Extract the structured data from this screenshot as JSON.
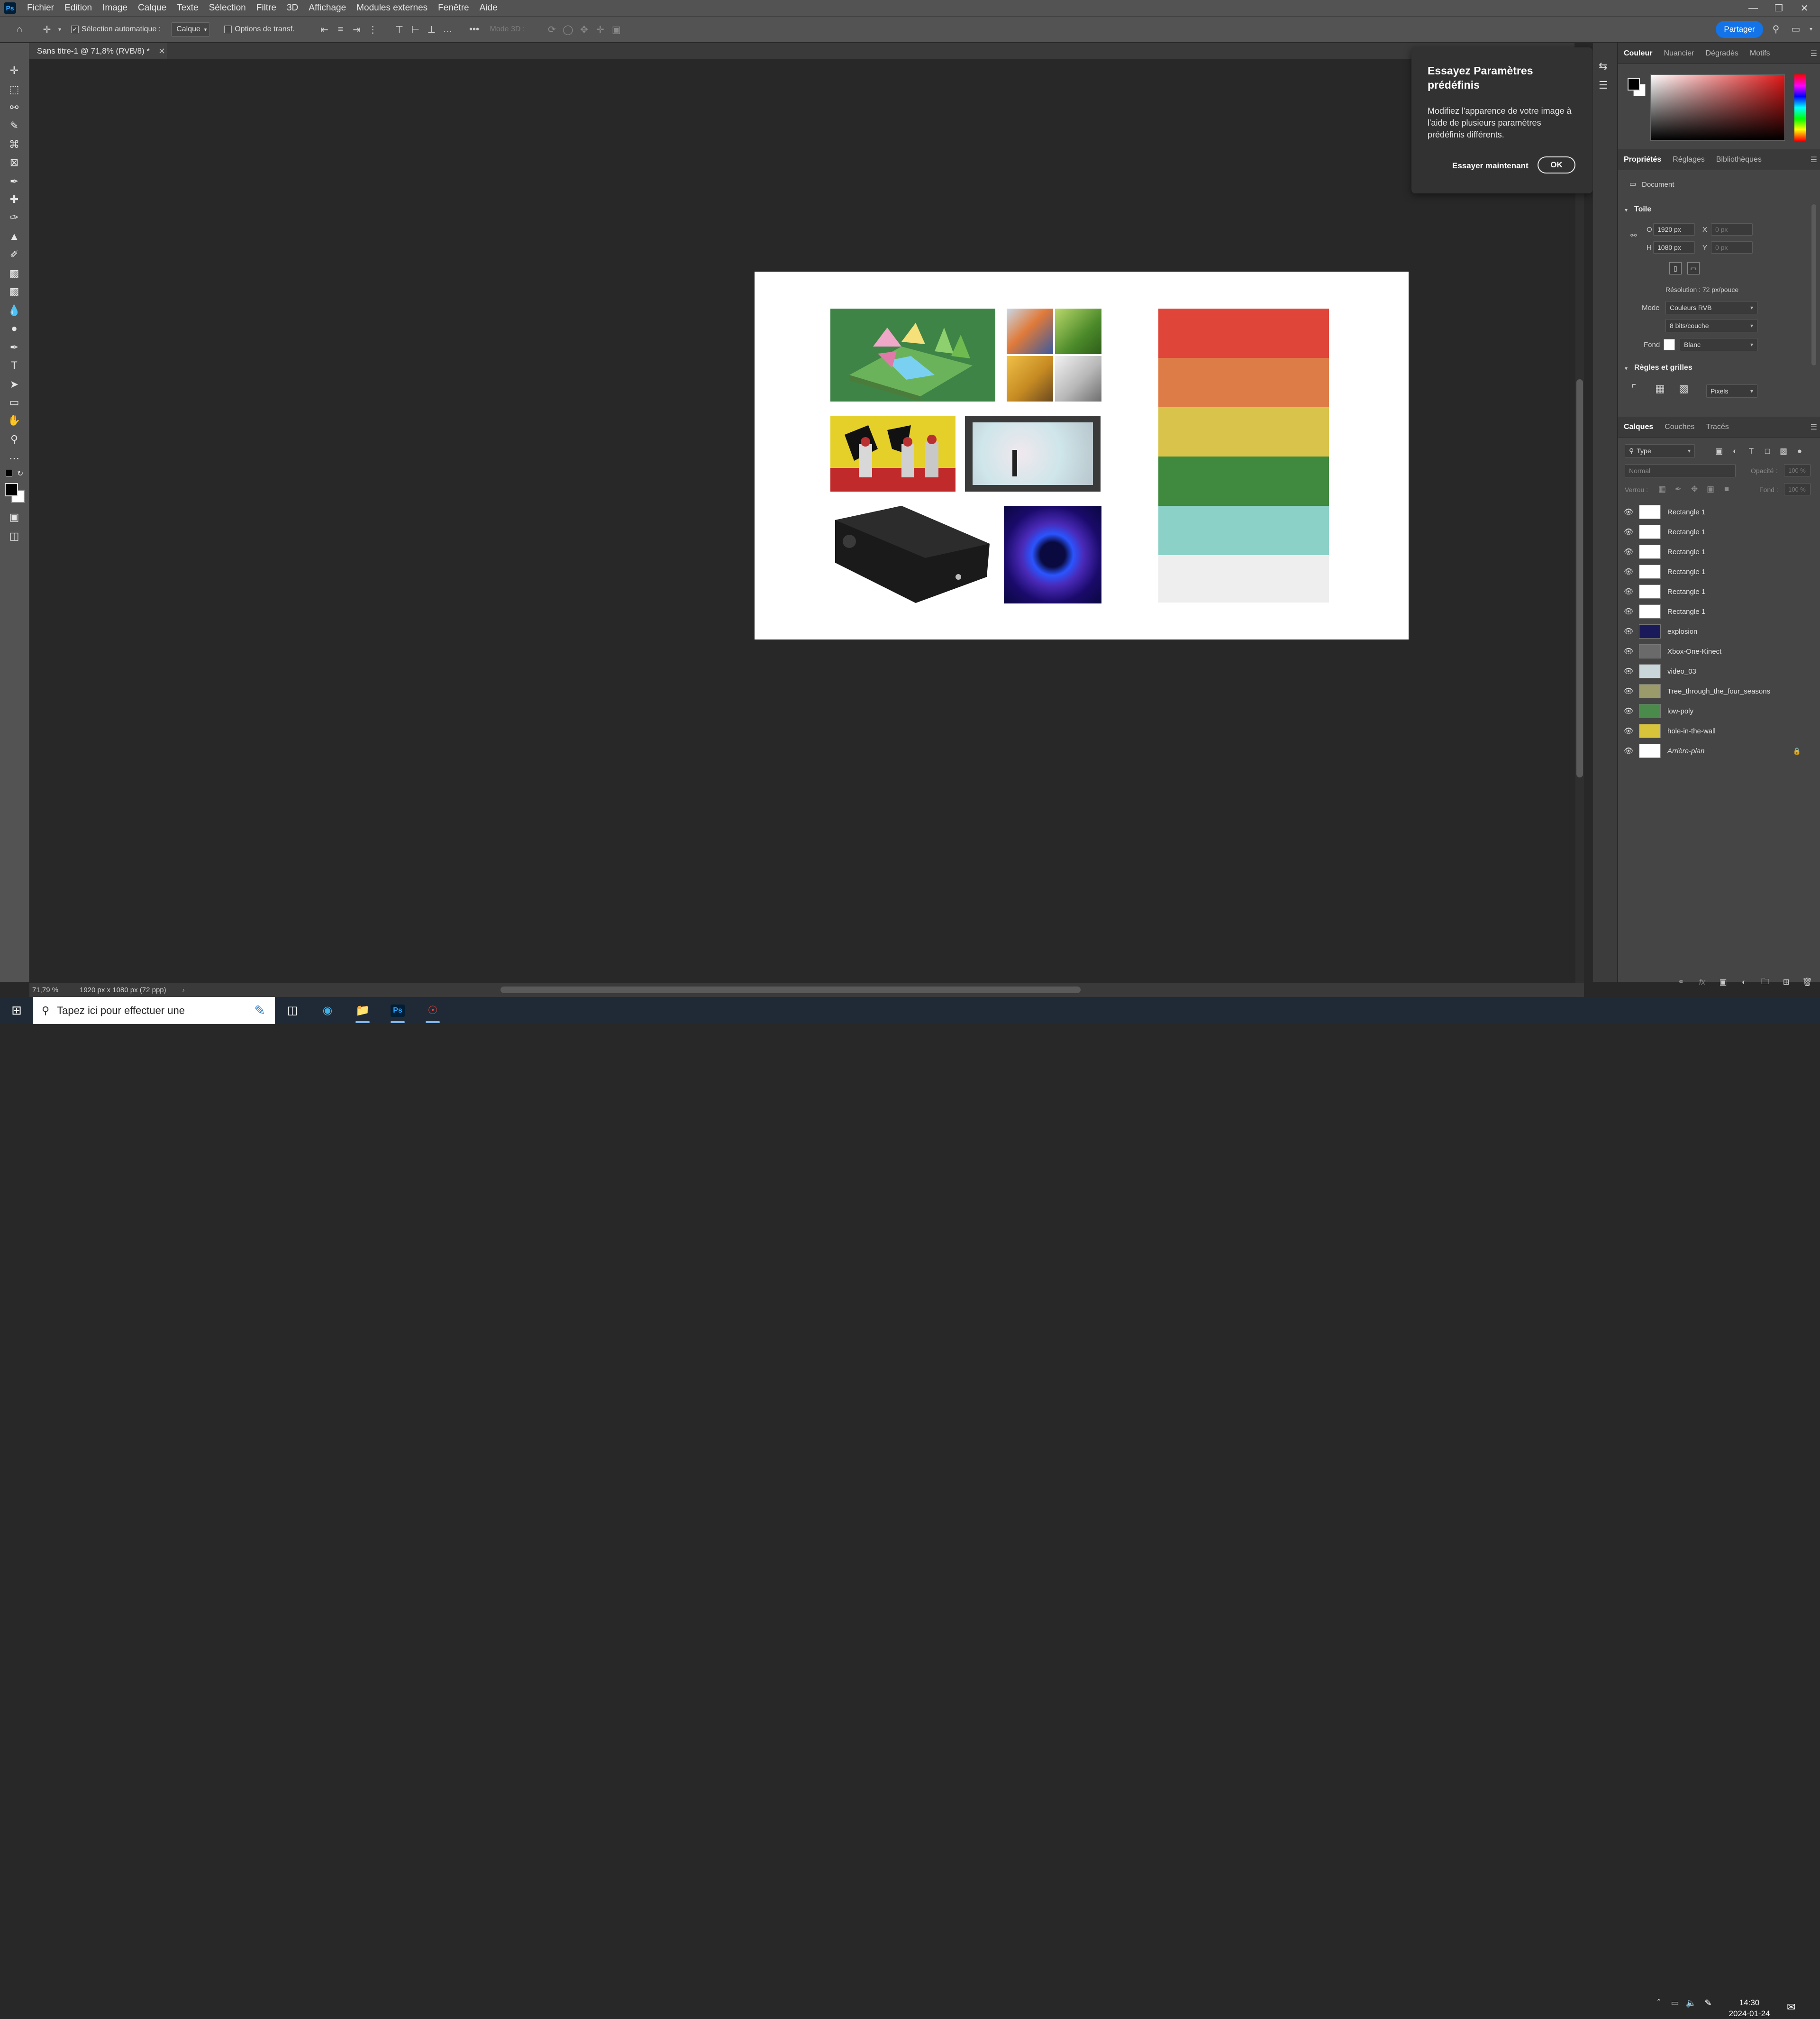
{
  "app": {
    "name": "Ps",
    "menu": [
      "Fichier",
      "Edition",
      "Image",
      "Calque",
      "Texte",
      "Sélection",
      "Filtre",
      "3D",
      "Affichage",
      "Modules externes",
      "Fenêtre",
      "Aide"
    ]
  },
  "options_bar": {
    "auto_select_label": "Sélection automatique :",
    "auto_select_value": "Calque",
    "transform_label": "Options de transf.",
    "mode3d_label": "Mode 3D :",
    "share_label": "Partager"
  },
  "document": {
    "tab_title": "Sans titre-1 @ 71,8% (RVB/8) *",
    "zoom": "71,79 %",
    "doc_info": "1920 px x 1080 px (72 ppp)"
  },
  "canvas": {
    "palette": [
      "#e0453a",
      "#de7c47",
      "#d9c34a",
      "#3f8a3e",
      "#8bd1c7",
      "#efeeee"
    ]
  },
  "popover": {
    "title": "Essayez Paramètres prédéfinis",
    "body": "Modifiez l'apparence de votre image à l'aide de plusieurs paramètres prédéfinis différents.",
    "try_label": "Essayer maintenant",
    "ok_label": "OK"
  },
  "color_panel": {
    "tabs": [
      "Couleur",
      "Nuancier",
      "Dégradés",
      "Motifs"
    ]
  },
  "properties_panel": {
    "tabs": [
      "Propriétés",
      "Réglages",
      "Bibliothèques"
    ],
    "doc_label": "Document",
    "canvas_section": "Toile",
    "w_label": "O",
    "w_value": "1920 px",
    "h_label": "H",
    "h_value": "1080 px",
    "x_label": "X",
    "x_value": "0 px",
    "y_label": "Y",
    "y_value": "0 px",
    "resolution": "Résolution : 72 px/pouce",
    "mode_label": "Mode",
    "mode_value": "Couleurs RVB",
    "bits_value": "8 bits/couche",
    "bg_label": "Fond",
    "bg_value": "Blanc",
    "rulers_section": "Règles et grilles",
    "units_value": "Pixels"
  },
  "layers_panel": {
    "tabs": [
      "Calques",
      "Couches",
      "Tracés"
    ],
    "filter_value": "Type",
    "blend_value": "Normal",
    "opacity_label": "Opacité :",
    "opacity_value": "100 %",
    "lock_label": "Verrou :",
    "fill_label": "Fond :",
    "fill_value": "100 %",
    "layers": [
      {
        "name": "Rectangle 1"
      },
      {
        "name": "Rectangle 1"
      },
      {
        "name": "Rectangle 1"
      },
      {
        "name": "Rectangle 1"
      },
      {
        "name": "Rectangle 1"
      },
      {
        "name": "Rectangle 1"
      },
      {
        "name": "explosion"
      },
      {
        "name": "Xbox-One-Kinect"
      },
      {
        "name": "video_03"
      },
      {
        "name": "Tree_through_the_four_seasons"
      },
      {
        "name": "low-poly"
      },
      {
        "name": "hole-in-the-wall"
      },
      {
        "name": "Arrière-plan"
      }
    ]
  },
  "taskbar": {
    "search_placeholder": "Tapez ici pour effectuer une",
    "time": "14:30",
    "date": "2024-01-24"
  }
}
